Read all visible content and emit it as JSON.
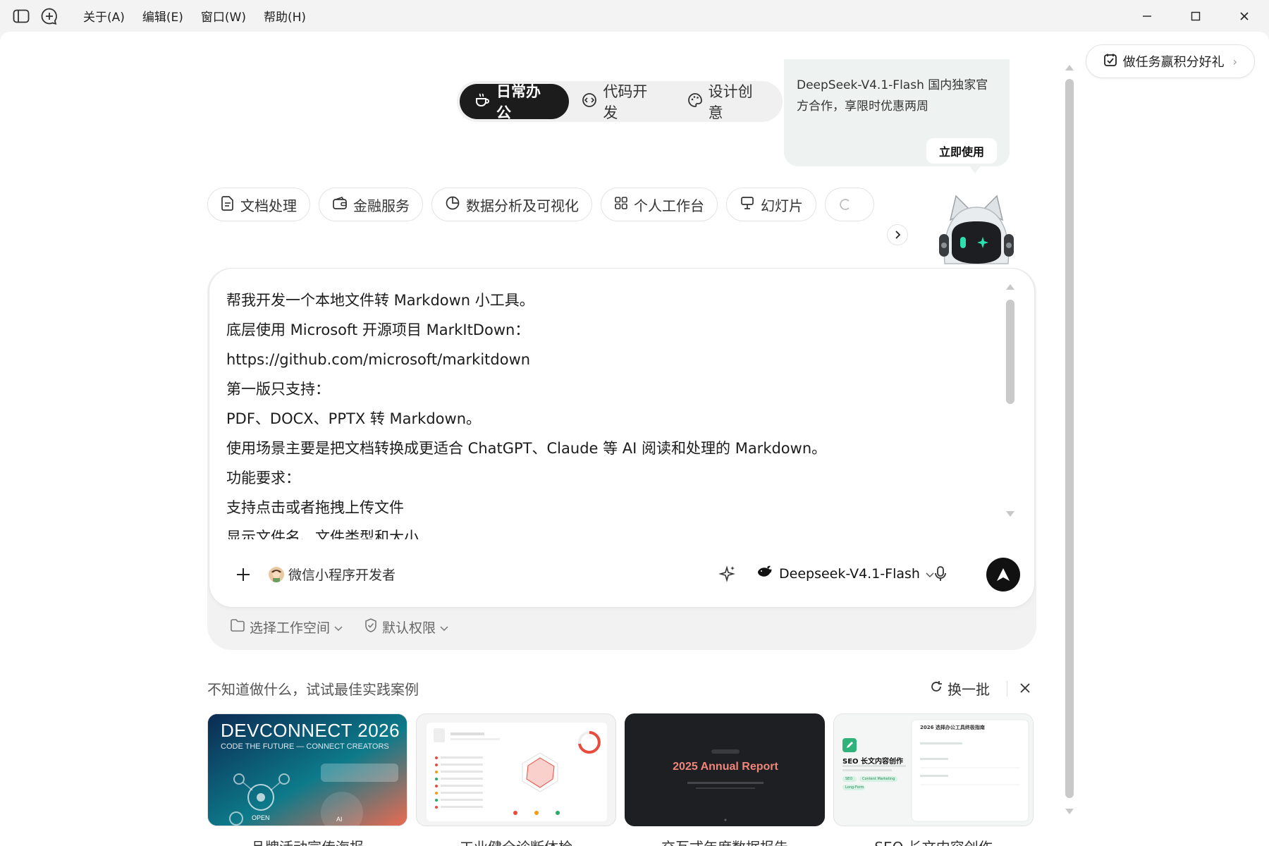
{
  "menu": {
    "about": "关于(A)",
    "edit": "编辑(E)",
    "window": "窗口(W)",
    "help": "帮助(H)"
  },
  "task_pill": {
    "label": "做任务赢积分好礼"
  },
  "modes": [
    {
      "label": "日常办公",
      "icon": "cup-icon",
      "active": true
    },
    {
      "label": "代码开发",
      "icon": "code-icon",
      "active": false
    },
    {
      "label": "设计创意",
      "icon": "palette-icon",
      "active": false
    }
  ],
  "promo": {
    "text": "DeepSeek-V4.1-Flash 国内独家官方合作，享限时优惠两周",
    "button": "立即使用"
  },
  "chips": [
    {
      "label": "文档处理",
      "icon": "document-icon"
    },
    {
      "label": "金融服务",
      "icon": "wallet-icon"
    },
    {
      "label": "数据分析及可视化",
      "icon": "pie-chart-icon"
    },
    {
      "label": "个人工作台",
      "icon": "grid-icon"
    },
    {
      "label": "幻灯片",
      "icon": "presentation-icon"
    }
  ],
  "prompt_lines": [
    "帮我开发一个本地文件转 Markdown 小工具。",
    "底层使用 Microsoft 开源项目 MarkItDown：",
    "https://github.com/microsoft/markitdown",
    "第一版只支持：",
    "PDF、DOCX、PPTX 转 Markdown。",
    "使用场景主要是把文档转换成更适合 ChatGPT、Claude 等 AI 阅读和处理的 Markdown。",
    "功能要求：",
    "支持点击或者拖拽上传文件",
    "显示文件名、文件类型和大小"
  ],
  "composer": {
    "agent": "微信小程序开发者",
    "model": "Deepseek-V4.1-Flash"
  },
  "workspace": {
    "select": "选择工作空间",
    "permission": "默认权限"
  },
  "suggestions": {
    "title": "不知道做什么，试试最佳实践案例",
    "refresh": "换一批",
    "cards": [
      {
        "caption": "品牌活动宣传海报",
        "headline": "DEVCONNECT 2026",
        "sub": "CODE THE FUTURE — CONNECT CREATORS",
        "tag1": "OPEN",
        "tag2": "AI"
      },
      {
        "caption": "工业健全诊断体检"
      },
      {
        "caption": "交互式年度数据报告",
        "headline": "2025 Annual Report"
      },
      {
        "caption": "SEO 长文内容创作",
        "headline": "SEO 长文内容创作",
        "side_title": "2026 选择办公工具终极指南",
        "tag1": "SEO",
        "tag2": "Content Marketing",
        "tag3": "Long-Form"
      }
    ]
  }
}
